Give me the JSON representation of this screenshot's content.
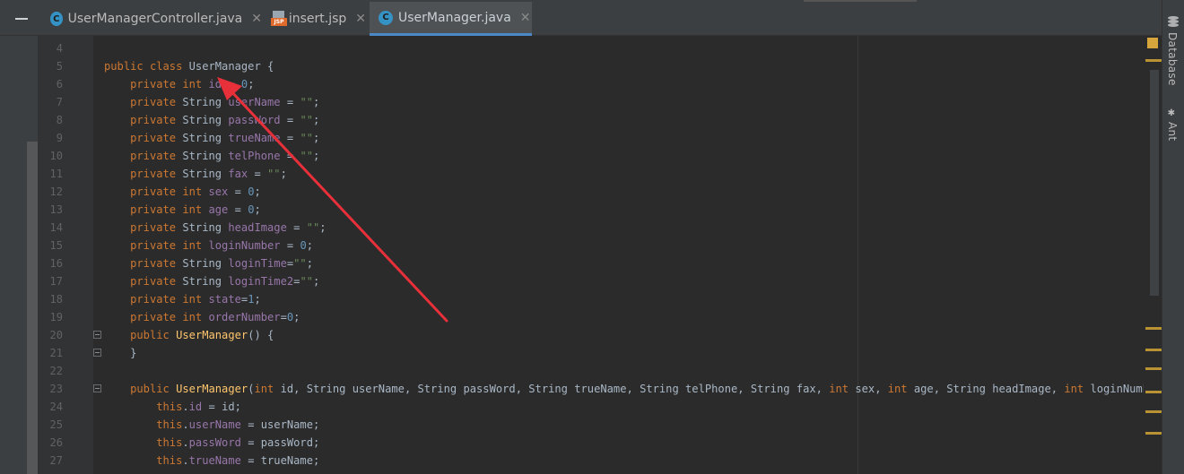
{
  "tabs": [
    {
      "label": "UserManagerController.java",
      "icon": "java-class-icon",
      "active": false,
      "close": "✕"
    },
    {
      "label": "insert.jsp",
      "icon": "jsp-file-icon",
      "active": false,
      "close": "✕"
    },
    {
      "label": "UserManager.java",
      "icon": "java-class-icon",
      "active": true,
      "close": "✕"
    }
  ],
  "class_icon_letter": "C",
  "jsp_icon_label": "JSP",
  "right_tools": [
    {
      "label": "Database",
      "icon": "database-icon"
    },
    {
      "label": "Ant",
      "icon": "ant-icon"
    }
  ],
  "line_numbers": [
    "4",
    "5",
    "6",
    "7",
    "8",
    "9",
    "10",
    "11",
    "12",
    "13",
    "14",
    "15",
    "16",
    "17",
    "18",
    "19",
    "20",
    "21",
    "22",
    "23",
    "24",
    "25",
    "26",
    "27"
  ],
  "code": [
    "",
    "public class UserManager {",
    "    private int id = 0;",
    "    private String userName = \"\";",
    "    private String passWord = \"\";",
    "    private String trueName = \"\";",
    "    private String telPhone = \"\";",
    "    private String fax = \"\";",
    "    private int sex = 0;",
    "    private int age = 0;",
    "    private String headImage = \"\";",
    "    private int loginNumber = 0;",
    "    private String loginTime=\"\";",
    "    private String loginTime2=\"\";",
    "    private int state=1;",
    "    private int orderNumber=0;",
    "    public UserManager() {",
    "    }",
    "",
    "    public UserManager(int id, String userName, String passWord, String trueName, String telPhone, String fax, int sex, int age, String headImage, int loginNumber,String",
    "        this.id = id;",
    "        this.userName = userName;",
    "        this.passWord = passWord;",
    "        this.trueName = trueName;"
  ],
  "colors": {
    "keyword": "#cc7832",
    "field": "#9876aa",
    "number": "#6897bb",
    "string": "#6a8759",
    "method": "#ffc66d",
    "plain": "#a9b7c6",
    "annotation_arrow": "#e8303a",
    "active_tab_underline": "#4a88c7"
  }
}
